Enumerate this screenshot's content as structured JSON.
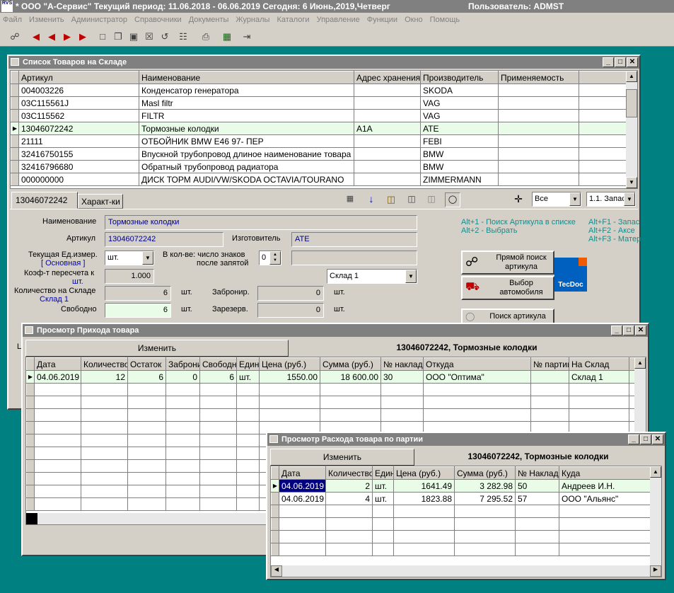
{
  "app": {
    "logo_text": "RVS",
    "title": "* ООО \"А-Сервис\"   Текущий период: 11.06.2018 - 06.06.2019   Сегодня:  6 Июнь,2019,Четверг",
    "user": "Пользователь: ADMST",
    "menu": [
      "Файл",
      "Изменить",
      "Администратор",
      "Справочники",
      "Документы",
      "Журналы",
      "Каталоги",
      "Управление",
      "Функции",
      "Окно",
      "Помощь"
    ]
  },
  "goods_window": {
    "title": "Список Товаров на Складе",
    "columns": [
      "Артикул",
      "Наименование",
      "Адрес хранения",
      "Производитель",
      "Применяемость"
    ],
    "rows": [
      [
        "004003226",
        "Конденсатор генератора",
        "",
        "SKODA",
        ""
      ],
      [
        "03C115561J",
        "Masl filtr",
        "",
        "VAG",
        ""
      ],
      [
        "03C115562",
        "FILTR",
        "",
        "VAG",
        ""
      ],
      [
        "13046072242",
        "Тормозные колодки",
        "A1A",
        "ATE",
        ""
      ],
      [
        "21111",
        "ОТБОЙНИК BMW E46 97- ПЕР",
        "",
        "FEBI",
        ""
      ],
      [
        "32416750155",
        "Впускной трубопровод длиное наименование товара",
        "",
        "BMW",
        ""
      ],
      [
        "32416796680",
        "Обратный трубопровод радиатора",
        "",
        "BMW",
        ""
      ],
      [
        "000000000",
        "ДИСК ТОРМ AUDI/VW/SKODA OCTAVIA/TOURANO",
        "",
        "ZIMMERMANN",
        ""
      ]
    ],
    "tabs": [
      "13046072242",
      "Характ-ки"
    ],
    "filter_value": "Все",
    "filter2_value": "1.1. Запас",
    "form": {
      "name_label": "Наименование",
      "name_value": "Тормозные колодки",
      "article_label": "Артикул",
      "article_value": "13046072242",
      "maker_label": "Изготовитель",
      "maker_value": "ATE",
      "unit_label": "Текущая  Ед.измер.",
      "unit_sub": "[ Основная ]",
      "unit_value": "шт.",
      "decimals_label_1": "В кол-ве: число знаков",
      "decimals_label_2": "после запятой",
      "decimals_value": "0",
      "coef_label_1": "Коэф-т пересчета к",
      "coef_label_2": "шт.",
      "coef_value": "1.000",
      "warehouse_value": "Склад 1",
      "qty_label": "Количество на Складе",
      "qty_sub": "Склад 1",
      "qty_value": "6",
      "qty_unit": "шт.",
      "free_label": "Свободно",
      "free_value": "6",
      "free_unit": "шт.",
      "reserved_label": "Забронир.",
      "reserved_value": "0",
      "reserved_unit": "шт.",
      "reserved2_label": "Зарезерв.",
      "reserved2_value": "0",
      "reserved2_unit": "шт."
    },
    "hints_left": [
      "Alt+1 - Поиск Артикула в списке",
      "Alt+2 - Выбрать"
    ],
    "hints_right": [
      "Alt+F1 - Запас",
      "Alt+F2 - Аксе",
      "Alt+F3 - Матер"
    ],
    "btn_direct_search": "Прямой поиск артикула",
    "btn_choose_car": "Выбор автомобиля",
    "btn_article_search": "Поиск артикула",
    "tecdoc": "TecDoc",
    "side_label": "Це"
  },
  "receipt_window": {
    "title": "Просмотр Прихода товара",
    "tab_edit": "Изменить",
    "header_info": "13046072242, Тормозные колодки",
    "columns": [
      "Дата",
      "Количество",
      "Остаток",
      "Забронир",
      "Свободно",
      "Един",
      "Цена (руб.)",
      "Сумма (руб.)",
      "№ накладной",
      "Откуда",
      "№ партии",
      "На Склад"
    ],
    "rows": [
      [
        "04.06.2019",
        "12",
        "6",
        "0",
        "6",
        "шт.",
        "1550.00",
        "18 600.00",
        "30",
        "ООО \"Оптима\"",
        "",
        "Склад 1"
      ]
    ]
  },
  "expense_window": {
    "title": "Просмотр Расхода товара по партии",
    "tab_edit": "Изменить",
    "header_info": "13046072242, Тормозные колодки",
    "columns": [
      "Дата",
      "Количество",
      "Един",
      "Цена (руб.)",
      "Сумма (руб.)",
      "№ Накладной",
      "Куда"
    ],
    "rows": [
      [
        "04.06.2019",
        "2",
        "шт.",
        "1641.49",
        "3 282.98",
        "50",
        "Андреев И.Н."
      ],
      [
        "04.06.2019",
        "4",
        "шт.",
        "1823.88",
        "7 295.52",
        "57",
        "ООО \"Альянс\""
      ]
    ]
  }
}
